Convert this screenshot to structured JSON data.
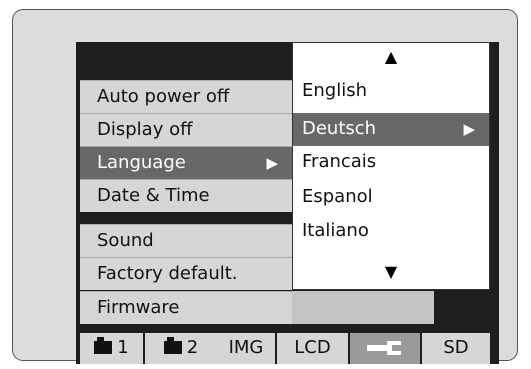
{
  "settings_menu": {
    "items": [
      {
        "label": "Auto power off"
      },
      {
        "label": "Display off"
      },
      {
        "label": "Language",
        "selected": true,
        "submenu_arrow": "▶"
      },
      {
        "label": "Date & Time"
      },
      {
        "label": "Sound"
      },
      {
        "label": "Factory default."
      },
      {
        "label": "Firmware"
      }
    ]
  },
  "language_popup": {
    "scroll_up": "▲",
    "scroll_down": "▼",
    "options": [
      {
        "label": "English"
      },
      {
        "label": "Deutsch",
        "selected": true,
        "submenu_arrow": "▶"
      },
      {
        "label": "Francais"
      },
      {
        "label": "Espanol"
      },
      {
        "label": "Italiano"
      }
    ]
  },
  "tabs": [
    {
      "label": "1",
      "icon": "camera-icon"
    },
    {
      "label": "2",
      "icon": "camera-icon"
    },
    {
      "label": "IMG"
    },
    {
      "label": "LCD"
    },
    {
      "label": "",
      "icon": "wrench-icon",
      "active": true
    },
    {
      "label": "SD"
    }
  ],
  "colors": {
    "menu_background": "#d6d6d6",
    "highlight": "#686868",
    "active_tab": "#9a9a9a",
    "screen": "#1e1e1e",
    "popup_background": "#ffffff"
  }
}
